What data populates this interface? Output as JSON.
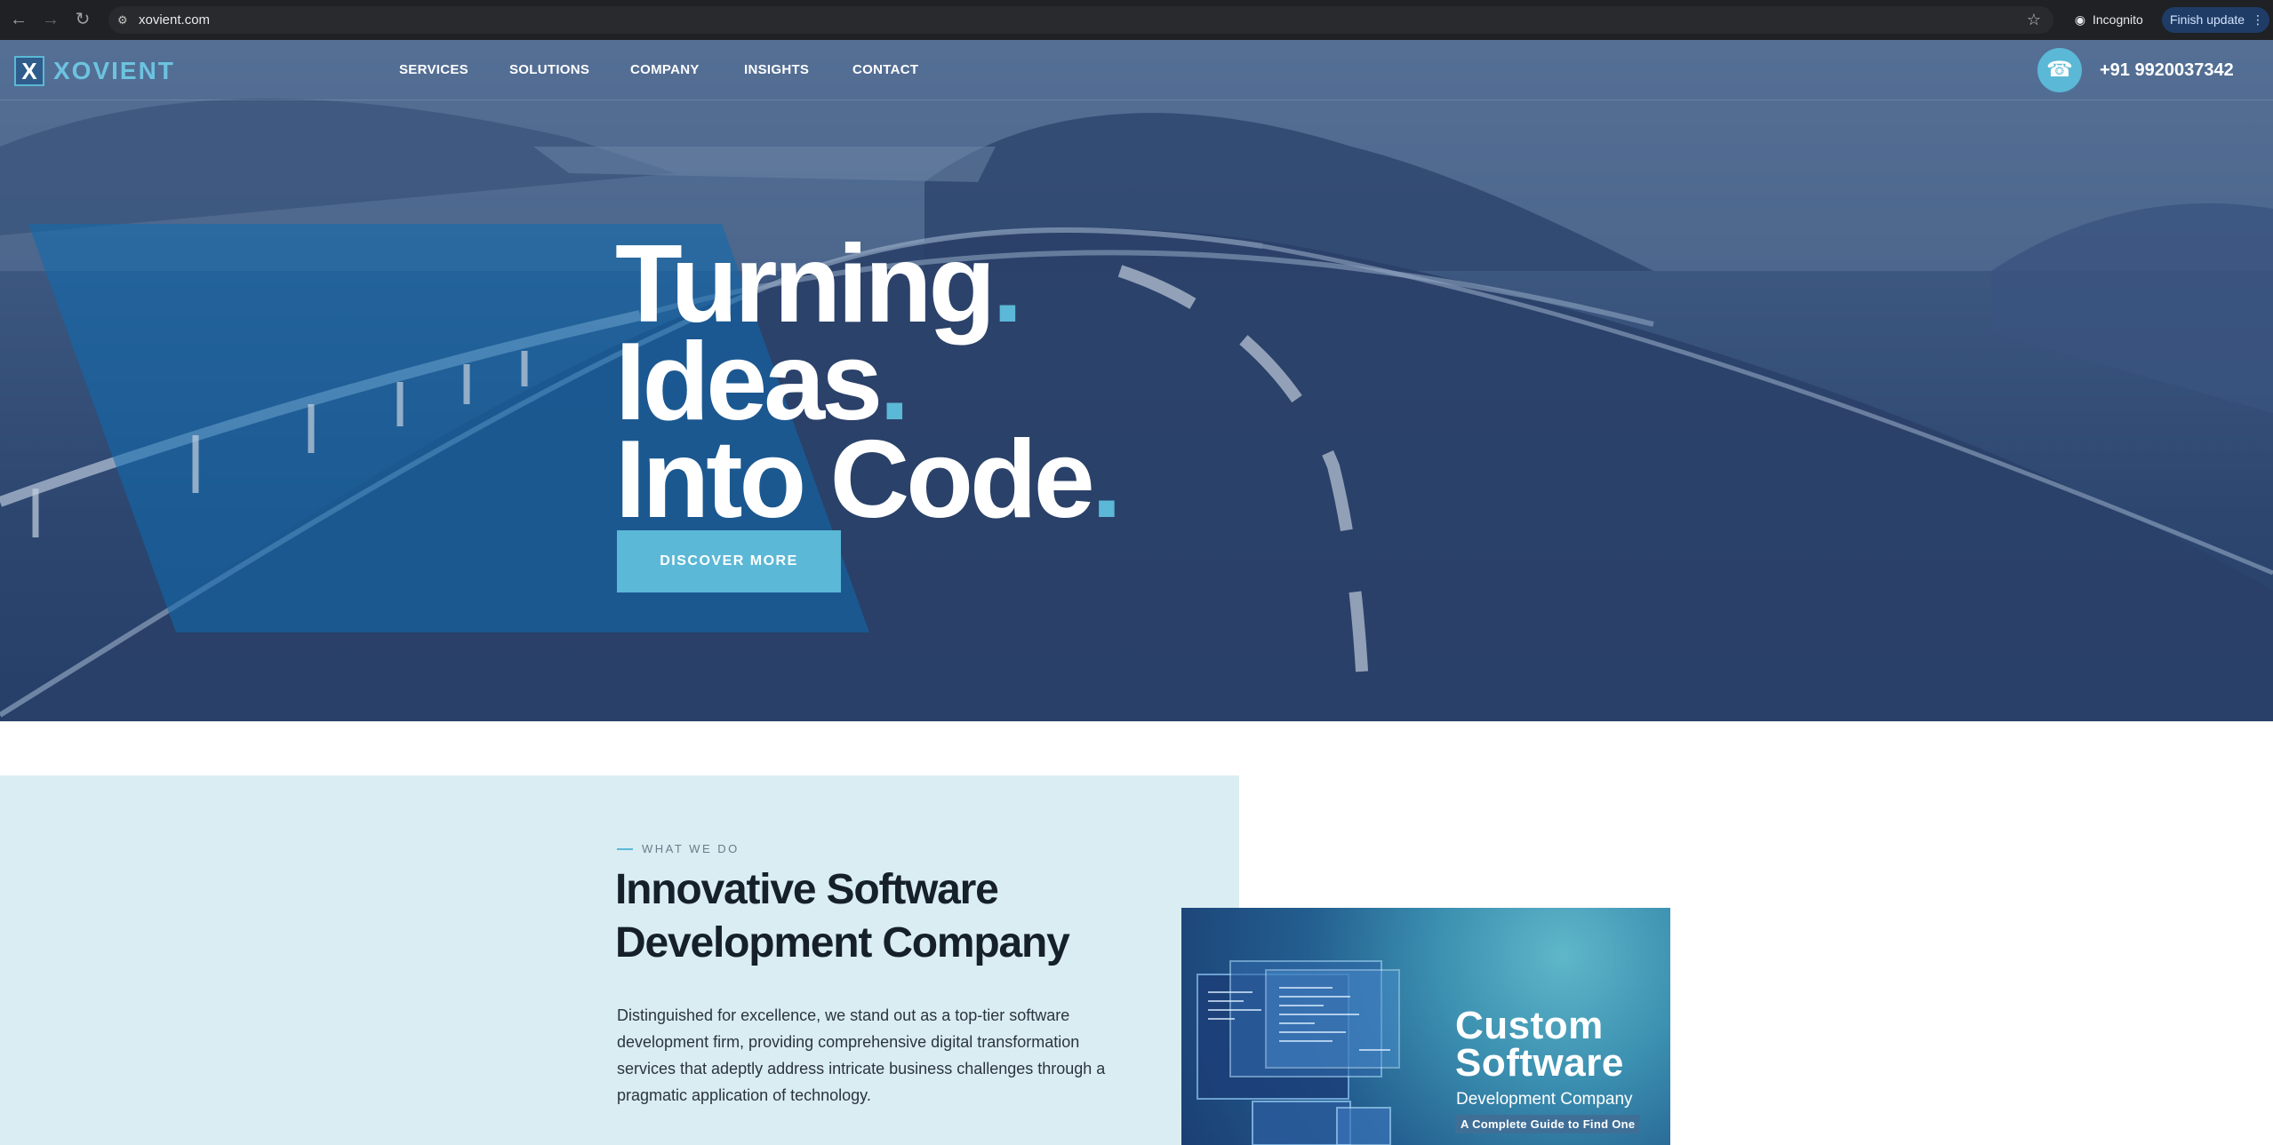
{
  "browser": {
    "url": "xovient.com",
    "incognito_label": "Incognito",
    "update_label": "Finish update"
  },
  "header": {
    "logo_mark": "X",
    "logo_text": "XOVIENT",
    "nav": [
      "SERVICES",
      "SOLUTIONS",
      "COMPANY",
      "INSIGHTS",
      "CONTACT"
    ],
    "phone": "+91 9920037342"
  },
  "hero": {
    "lines": [
      "Turning",
      "Ideas",
      "Into Code"
    ],
    "dot": ".",
    "cta": "DISCOVER MORE",
    "accent_color": "#5bb8d6"
  },
  "what_we_do": {
    "eyebrow": "WHAT WE DO",
    "title_line1": "Innovative Software",
    "title_line2": "Development Company",
    "body": "Distinguished for excellence, we stand out as a top-tier software development firm, providing comprehensive digital transformation services that adeptly address intricate business challenges through a pragmatic application of technology."
  },
  "promo": {
    "title_line1": "Custom",
    "title_line2": "Software",
    "subtitle": "Development Company",
    "tag": "A Complete Guide to Find One"
  }
}
